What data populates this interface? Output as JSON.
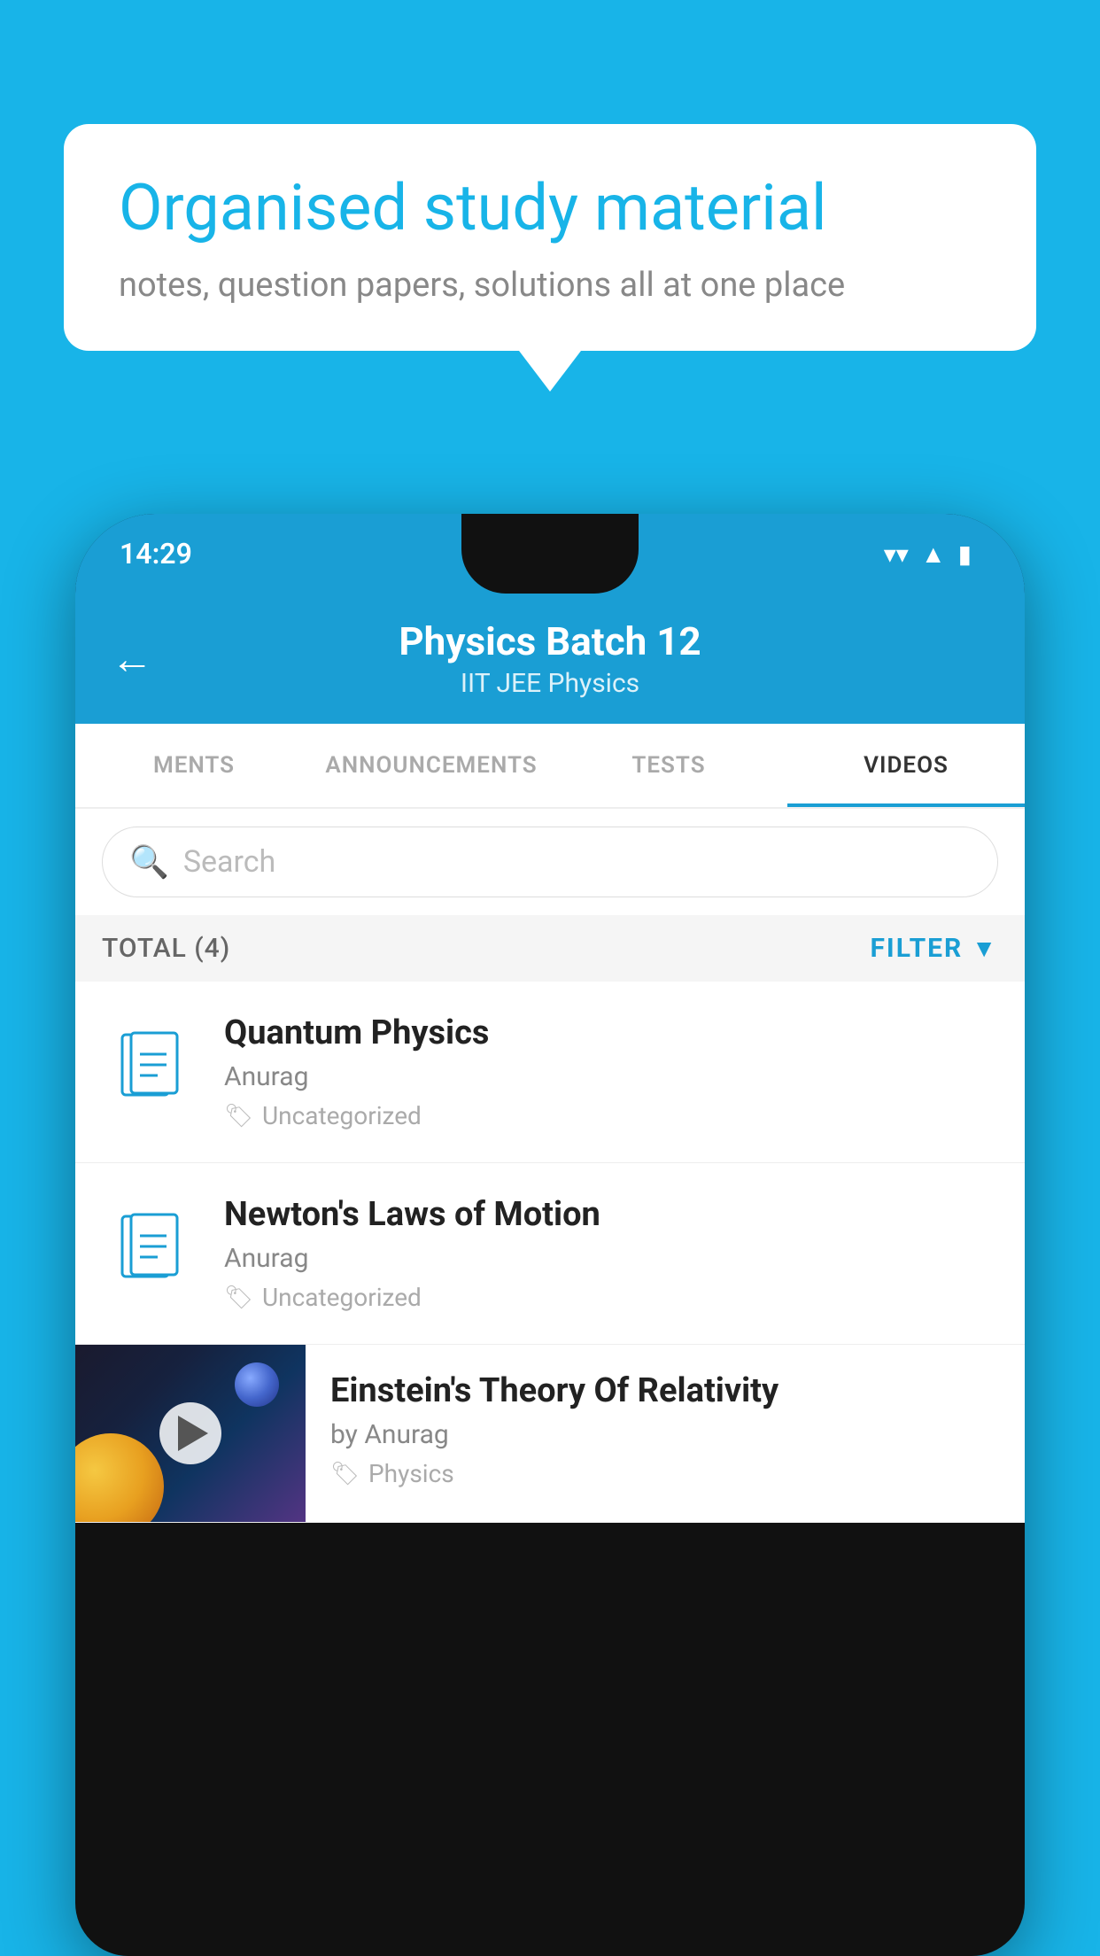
{
  "background": {
    "color": "#18b4e8"
  },
  "speech_bubble": {
    "title": "Organised study material",
    "subtitle": "notes, question papers, solutions all at one place"
  },
  "status_bar": {
    "time": "14:29",
    "wifi": "▼",
    "signal": "▲",
    "battery": "▮"
  },
  "app_header": {
    "back_label": "←",
    "title": "Physics Batch 12",
    "subtitle": "IIT JEE   Physics"
  },
  "tabs": [
    {
      "label": "MENTS",
      "active": false
    },
    {
      "label": "ANNOUNCEMENTS",
      "active": false
    },
    {
      "label": "TESTS",
      "active": false
    },
    {
      "label": "VIDEOS",
      "active": true
    }
  ],
  "search": {
    "placeholder": "Search"
  },
  "filter_bar": {
    "total_label": "TOTAL (4)",
    "filter_label": "FILTER"
  },
  "videos": [
    {
      "title": "Quantum Physics",
      "author": "Anurag",
      "tag": "Uncategorized",
      "has_thumb": false
    },
    {
      "title": "Newton's Laws of Motion",
      "author": "Anurag",
      "tag": "Uncategorized",
      "has_thumb": false
    },
    {
      "title": "Einstein's Theory Of Relativity",
      "author": "by Anurag",
      "tag": "Physics",
      "has_thumb": true
    }
  ]
}
